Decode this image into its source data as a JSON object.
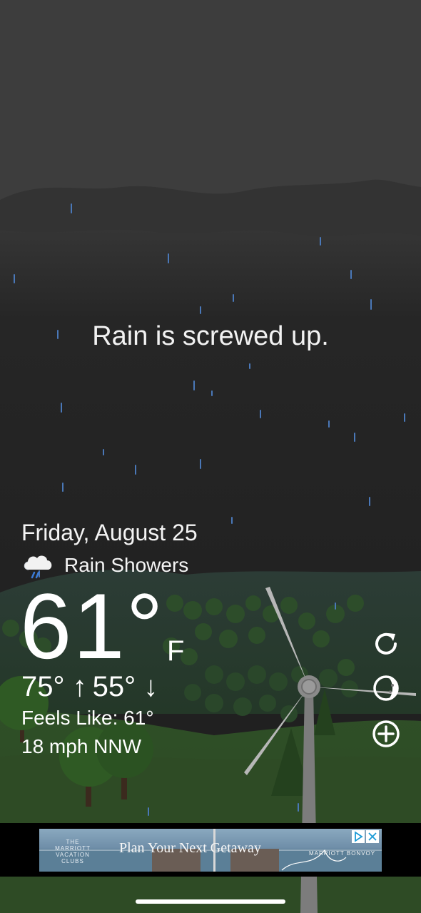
{
  "headline": "Rain is screwed up.",
  "weather": {
    "date": "Friday, August 25",
    "condition": "Rain Showers",
    "condition_icon": "rain-cloud-icon",
    "temperature": "61°",
    "unit": "F",
    "high": "75° ↑",
    "low": "55° ↓",
    "feels_like": "Feels Like: 61°",
    "wind": "18 mph NNW"
  },
  "controls": [
    {
      "name": "refresh-icon"
    },
    {
      "name": "moon-phase-icon"
    },
    {
      "name": "add-location-icon"
    }
  ],
  "ad": {
    "logo_text": "THE MARRIOTT VACATION CLUBS",
    "headline": "Plan Your Next Getaway",
    "brand": "MARRIOTT BONVOY",
    "icons": [
      "ad-choices-icon",
      "close-icon"
    ]
  },
  "colors": {
    "sky_top": "#3f3f3f",
    "sky_bottom": "#1f1f1f",
    "rain": "#4a78b8",
    "hills": "#2f4a2a",
    "ground": "#2c4a24",
    "ad_background": "#000000"
  }
}
